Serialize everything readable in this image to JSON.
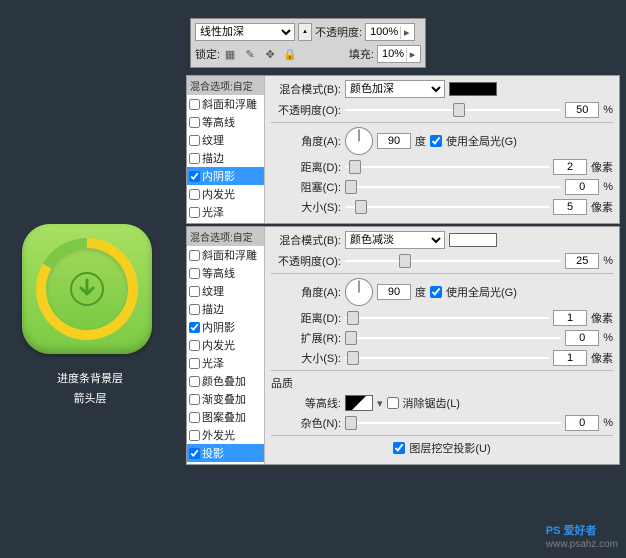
{
  "topbar": {
    "blend_mode": "线性加深",
    "opacity_label": "不透明度:",
    "opacity_value": "100%",
    "lock_label": "锁定:",
    "fill_label": "填充:",
    "fill_value": "10%"
  },
  "caption": {
    "line1": "进度条背景层",
    "line2": "箭头层"
  },
  "panel1": {
    "header": "混合选项:自定",
    "styles": [
      {
        "label": "斜面和浮雕",
        "checked": false,
        "sel": false
      },
      {
        "label": "等高线",
        "checked": false,
        "sel": false
      },
      {
        "label": "纹理",
        "checked": false,
        "sel": false
      },
      {
        "label": "描边",
        "checked": false,
        "sel": false
      },
      {
        "label": "内阴影",
        "checked": true,
        "sel": true
      },
      {
        "label": "内发光",
        "checked": false,
        "sel": false
      },
      {
        "label": "光泽",
        "checked": false,
        "sel": false
      }
    ],
    "blend_label": "混合模式(B):",
    "blend_value": "颜色加深",
    "opacity_label": "不透明度(O):",
    "opacity_value": "50",
    "pct": "%",
    "angle_label": "角度(A):",
    "angle_value": "90",
    "deg": "度",
    "global_label": "使用全局光(G)",
    "distance_label": "距离(D):",
    "distance_value": "2",
    "px": "像素",
    "choke_label": "阻塞(C):",
    "choke_value": "0",
    "size_label": "大小(S):",
    "size_value": "5"
  },
  "panel2": {
    "header": "混合选项:自定",
    "styles": [
      {
        "label": "斜面和浮雕",
        "checked": false,
        "sel": false
      },
      {
        "label": "等高线",
        "checked": false,
        "sel": false
      },
      {
        "label": "纹理",
        "checked": false,
        "sel": false
      },
      {
        "label": "描边",
        "checked": false,
        "sel": false
      },
      {
        "label": "内阴影",
        "checked": true,
        "sel": false
      },
      {
        "label": "内发光",
        "checked": false,
        "sel": false
      },
      {
        "label": "光泽",
        "checked": false,
        "sel": false
      },
      {
        "label": "颜色叠加",
        "checked": false,
        "sel": false
      },
      {
        "label": "渐变叠加",
        "checked": false,
        "sel": false
      },
      {
        "label": "图案叠加",
        "checked": false,
        "sel": false
      },
      {
        "label": "外发光",
        "checked": false,
        "sel": false
      },
      {
        "label": "投影",
        "checked": true,
        "sel": true
      }
    ],
    "blend_label": "混合模式(B):",
    "blend_value": "颜色减淡",
    "opacity_label": "不透明度(O):",
    "opacity_value": "25",
    "pct": "%",
    "angle_label": "角度(A):",
    "angle_value": "90",
    "deg": "度",
    "global_label": "使用全局光(G)",
    "distance_label": "距离(D):",
    "distance_value": "1",
    "px": "像素",
    "spread_label": "扩展(R):",
    "spread_value": "0",
    "size_label": "大小(S):",
    "size_value": "1",
    "quality_label": "品质",
    "contour_label": "等高线:",
    "antialias_label": "消除锯齿(L)",
    "noise_label": "杂色(N):",
    "noise_value": "0",
    "knockout_label": "图层挖空投影(U)"
  },
  "watermark": {
    "text": "PS 爱好者",
    "url": "www.psahz.com"
  }
}
